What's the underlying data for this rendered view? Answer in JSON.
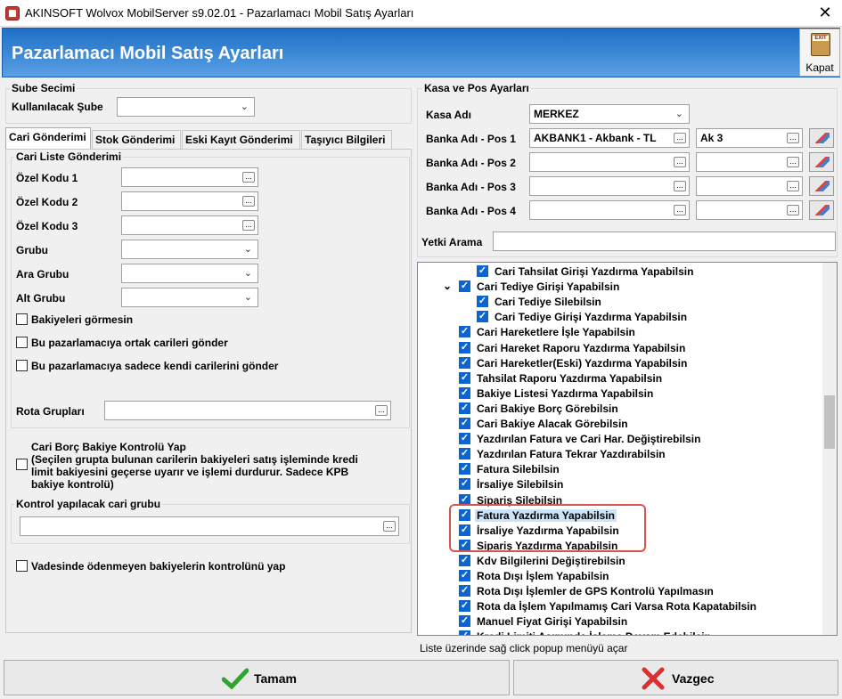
{
  "window": {
    "title": "AKINSOFT Wolvox MobilServer s9.02.01 - Pazarlamacı Mobil Satış Ayarları",
    "close": "✕"
  },
  "header": {
    "title": "Pazarlamacı Mobil Satış Ayarları",
    "kapat": "Kapat"
  },
  "sube": {
    "group": "Sube Secimi",
    "label": "Kullanılacak Şube",
    "value": ""
  },
  "tabs": [
    "Cari Gönderimi",
    "Stok Gönderimi",
    "Eski Kayıt Gönderimi",
    "Taşıyıcı Bilgileri"
  ],
  "cari": {
    "group": "Cari Liste Gönderimi",
    "fields": [
      "Özel Kodu 1",
      "Özel Kodu 2",
      "Özel Kodu 3",
      "Grubu",
      "Ara Grubu",
      "Alt Grubu"
    ],
    "checks": [
      "Bakiyeleri görmesin",
      "Bu pazarlamacıya ortak carileri gönder",
      "Bu pazarlamacıya sadece kendi carilerini gönder"
    ],
    "rota_label": "Rota Grupları",
    "borc_title": "Cari Borç Bakiye Kontrolü Yap",
    "borc_desc1": "(Seçilen grupta bulunan carilerin bakiyeleri satış işleminde kredi",
    "borc_desc2": "limit bakiyesini geçerse uyarır ve işlemi durdurur. Sadece KPB",
    "borc_desc3": "bakiye kontrolü)",
    "kontrol_group": "Kontrol yapılacak cari grubu",
    "vade": "Vadesinde ödenmeyen bakiyelerin kontrolünü yap"
  },
  "kasa": {
    "group": "Kasa ve Pos Ayarları",
    "kasa_label": "Kasa Adı",
    "kasa_value": "MERKEZ",
    "pos": [
      {
        "label": "Banka Adı - Pos 1",
        "bank": "AKBANK1 - Akbank - TL",
        "acc": "Ak 3"
      },
      {
        "label": "Banka Adı - Pos 2",
        "bank": "",
        "acc": ""
      },
      {
        "label": "Banka Adı - Pos 3",
        "bank": "",
        "acc": ""
      },
      {
        "label": "Banka Adı - Pos 4",
        "bank": "",
        "acc": ""
      }
    ],
    "yetki_label": "Yetki Arama",
    "yetki_value": ""
  },
  "tree": [
    {
      "text": "Cari Tahsilat Girişi Yazdırma Yapabilsin",
      "level": 2
    },
    {
      "text": "Cari Tediye Girişi Yapabilsin",
      "level": 1,
      "expander": "⌄"
    },
    {
      "text": "Cari Tediye Silebilsin",
      "level": 2
    },
    {
      "text": "Cari Tediye Girişi Yazdırma Yapabilsin",
      "level": 2
    },
    {
      "text": "Cari Hareketlere İşle Yapabilsin",
      "level": 1
    },
    {
      "text": "Cari Hareket Raporu Yazdırma Yapabilsin",
      "level": 1
    },
    {
      "text": "Cari Hareketler(Eski) Yazdırma Yapabilsin",
      "level": 1
    },
    {
      "text": "Tahsilat Raporu Yazdırma Yapabilsin",
      "level": 1
    },
    {
      "text": "Bakiye Listesi Yazdırma Yapabilsin",
      "level": 1
    },
    {
      "text": "Cari Bakiye Borç Görebilsin",
      "level": 1
    },
    {
      "text": "Cari Bakiye Alacak Görebilsin",
      "level": 1
    },
    {
      "text": "Yazdırılan Fatura ve Cari Har. Değiştirebilsin",
      "level": 1
    },
    {
      "text": "Yazdırılan Fatura Tekrar Yazdırabilsin",
      "level": 1
    },
    {
      "text": "Fatura Silebilsin",
      "level": 1
    },
    {
      "text": "İrsaliye Silebilsin",
      "level": 1
    },
    {
      "text": "Sipariş Silebilsin",
      "level": 1
    },
    {
      "text": "Fatura Yazdırma Yapabilsin",
      "level": 1,
      "selected": true
    },
    {
      "text": "İrsaliye Yazdırma Yapabilsin",
      "level": 1
    },
    {
      "text": "Sipariş Yazdırma Yapabilsin",
      "level": 1
    },
    {
      "text": "Kdv Bilgilerini Değiştirebilsin",
      "level": 1
    },
    {
      "text": "Rota Dışı İşlem Yapabilsin",
      "level": 1
    },
    {
      "text": "Rota Dışı İşlemler de GPS Kontrolü Yapılmasın",
      "level": 1
    },
    {
      "text": "Rota da İşlem Yapılmamış Cari Varsa Rota Kapatabilsin",
      "level": 1
    },
    {
      "text": "Manuel Fiyat Girişi Yapabilsin",
      "level": 1
    },
    {
      "text": "Kredi Limiti Aşımında İşleme Devam Edebilsin",
      "level": 1
    }
  ],
  "status": "Liste üzerinde sağ click popup menüyü açar",
  "buttons": {
    "ok": "Tamam",
    "cancel": "Vazgec"
  },
  "colors": {
    "header": "#1e6fc6",
    "check": "#0a64d1",
    "highlight": "#d9534f"
  }
}
